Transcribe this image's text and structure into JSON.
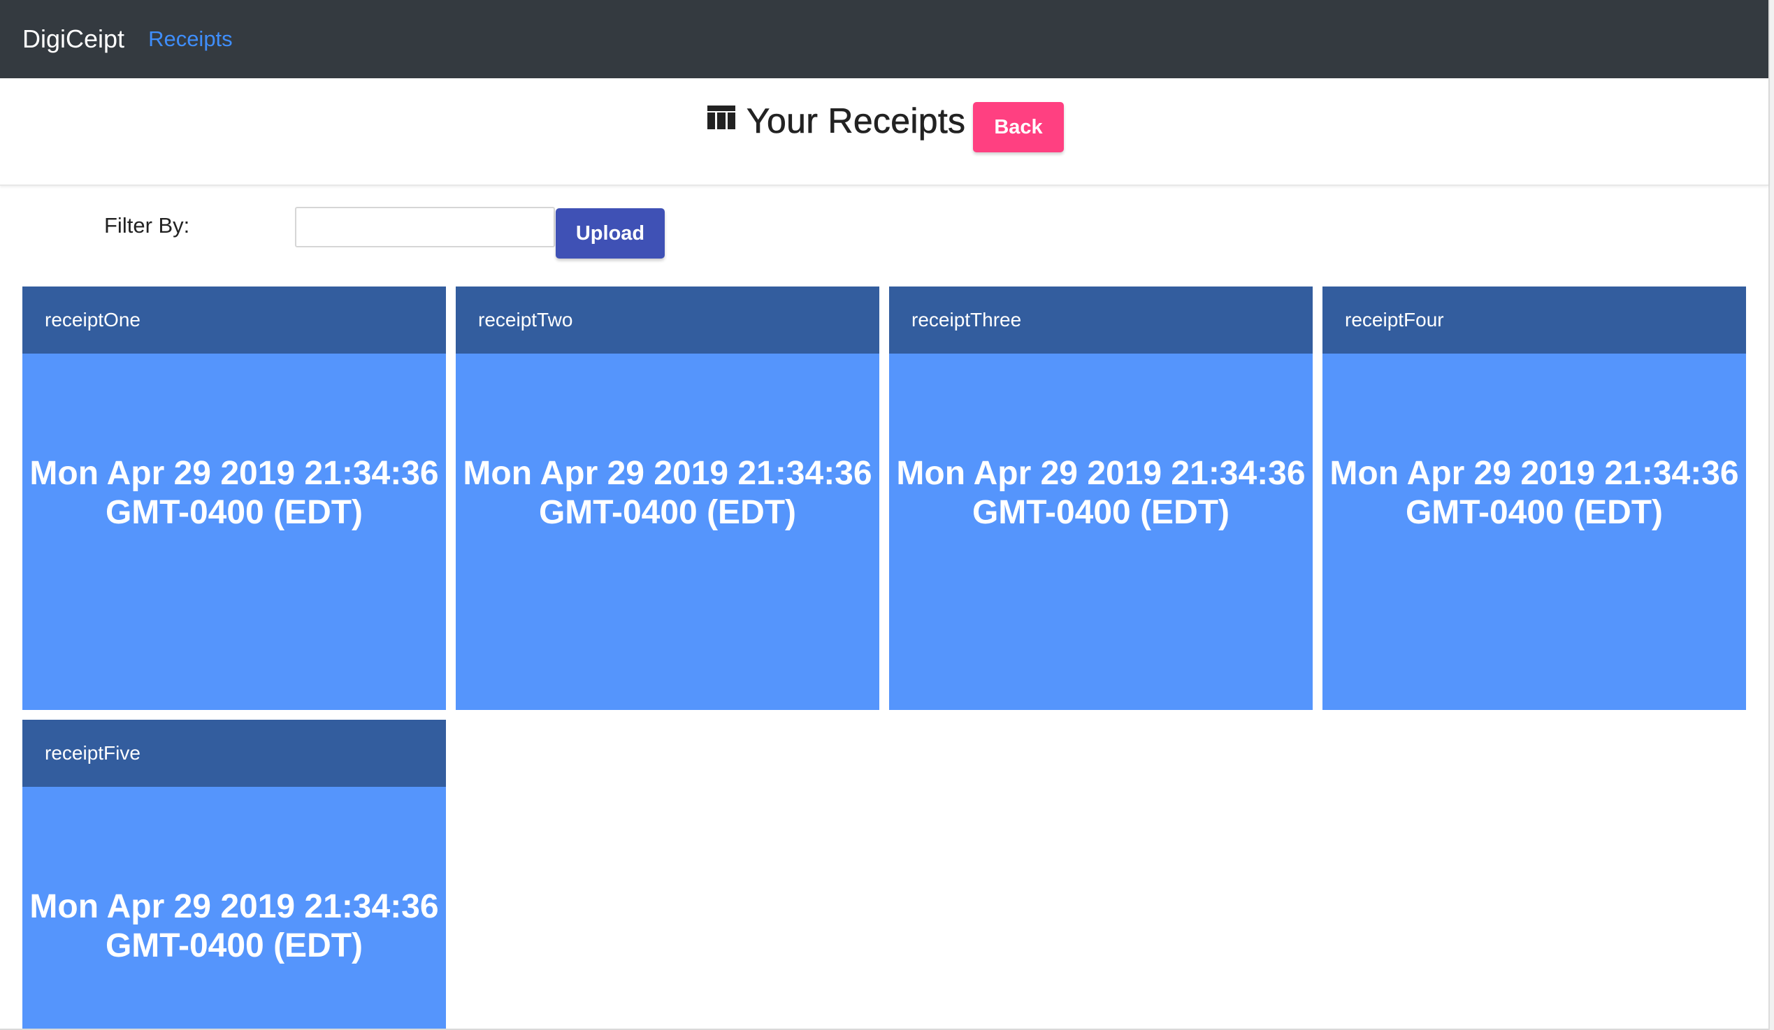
{
  "navbar": {
    "brand": "DigiCeipt",
    "link": "Receipts"
  },
  "header": {
    "icon": "table-icon",
    "title": "Your Receipts",
    "back_label": "Back"
  },
  "filter": {
    "label": "Filter By:",
    "value": "",
    "placeholder": "",
    "upload_label": "Upload"
  },
  "receipts": [
    {
      "name": "receiptOne",
      "date": "Mon Apr 29 2019 21:34:36 GMT-0400 (EDT)"
    },
    {
      "name": "receiptTwo",
      "date": "Mon Apr 29 2019 21:34:36 GMT-0400 (EDT)"
    },
    {
      "name": "receiptThree",
      "date": "Mon Apr 29 2019 21:34:36 GMT-0400 (EDT)"
    },
    {
      "name": "receiptFour",
      "date": "Mon Apr 29 2019 21:34:36 GMT-0400 (EDT)"
    },
    {
      "name": "receiptFive",
      "date": "Mon Apr 29 2019 21:34:36 GMT-0400 (EDT)"
    }
  ],
  "colors": {
    "navbar": "#343a40",
    "nav_link": "#3f8efc",
    "back_button": "#ff4081",
    "upload_button": "#3f51b5",
    "card_header": "#335d9e",
    "card_body": "#5595fc"
  }
}
